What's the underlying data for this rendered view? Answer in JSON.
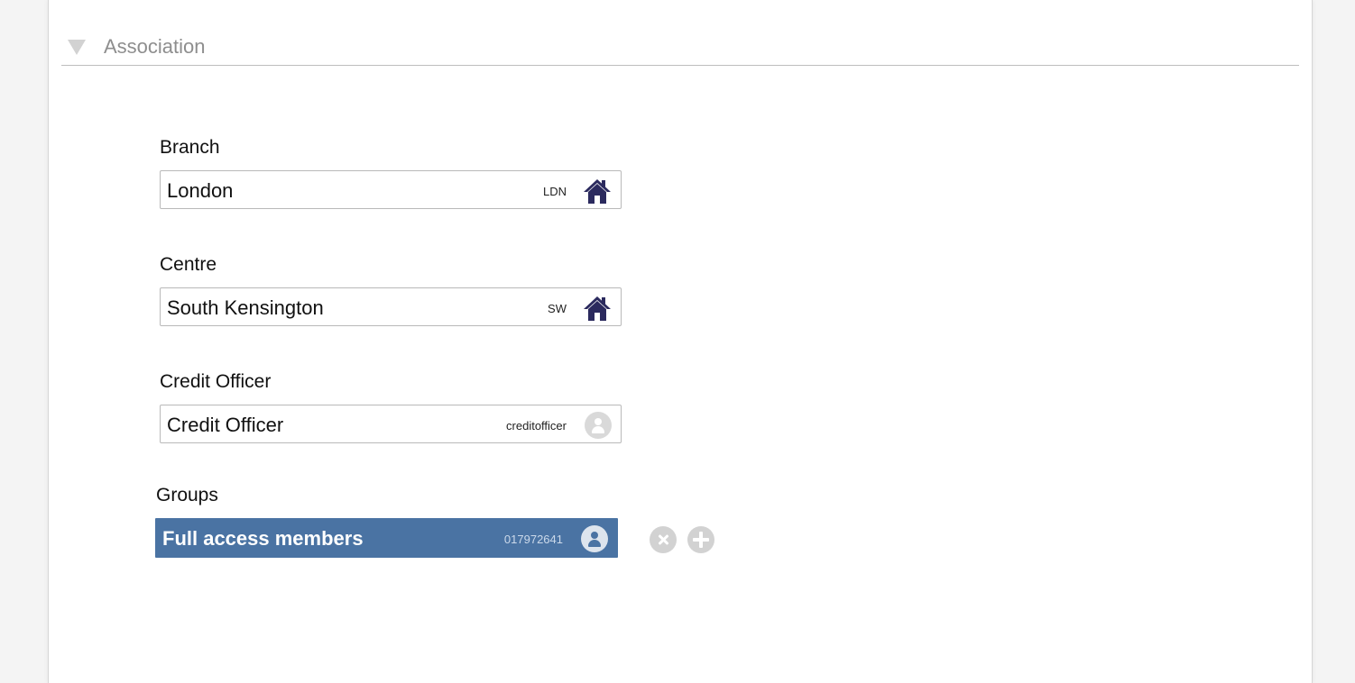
{
  "section": {
    "title": "Association"
  },
  "branch": {
    "label": "Branch",
    "value": "London",
    "code": "LDN",
    "icon": "home-icon"
  },
  "centre": {
    "label": "Centre",
    "value": "South Kensington",
    "code": "SW",
    "icon": "home-icon"
  },
  "credit_officer": {
    "label": "Credit Officer",
    "value": "Credit Officer",
    "code": "creditofficer",
    "icon": "user-avatar-icon"
  },
  "groups": {
    "label": "Groups",
    "value": "Full access members",
    "code": "017972641",
    "icon": "user-avatar-icon",
    "selected": true,
    "remove_icon": "remove-icon",
    "add_icon": "add-icon"
  },
  "colors": {
    "icon_navy": "#2b2a5e",
    "selected_bg": "#4a73a3",
    "muted_gray": "#d2d2d2"
  }
}
